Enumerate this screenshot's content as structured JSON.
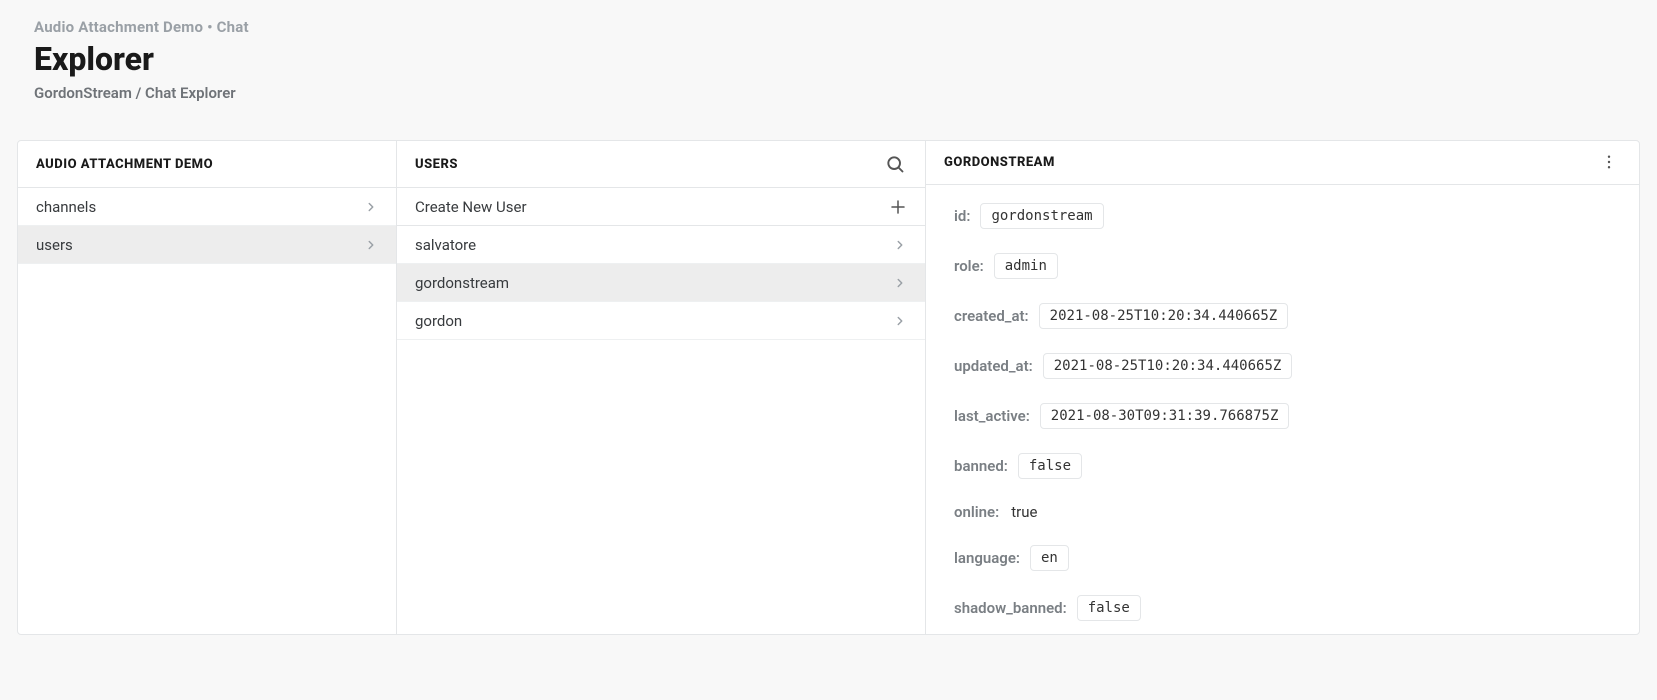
{
  "header": {
    "sup": "Audio Attachment Demo • Chat",
    "title": "Explorer",
    "breadcrumb": "GordonStream / Chat Explorer"
  },
  "panel_left": {
    "title": "Audio Attachment Demo",
    "items": [
      {
        "label": "channels",
        "selected": false
      },
      {
        "label": "users",
        "selected": true
      }
    ]
  },
  "panel_middle": {
    "title": "Users",
    "create_label": "Create New User",
    "items": [
      {
        "label": "salvatore",
        "selected": false
      },
      {
        "label": "gordonstream",
        "selected": true
      },
      {
        "label": "gordon",
        "selected": false
      }
    ]
  },
  "panel_right": {
    "title": "GordonStream",
    "fields": [
      {
        "label": "id:",
        "value": "gordonstream",
        "code": true
      },
      {
        "label": "role:",
        "value": "admin",
        "code": true
      },
      {
        "label": "created_at:",
        "value": "2021-08-25T10:20:34.440665Z",
        "code": true
      },
      {
        "label": "updated_at:",
        "value": "2021-08-25T10:20:34.440665Z",
        "code": true
      },
      {
        "label": "last_active:",
        "value": "2021-08-30T09:31:39.766875Z",
        "code": true
      },
      {
        "label": "banned:",
        "value": "false",
        "code": true
      },
      {
        "label": "online:",
        "value": "true",
        "code": false
      },
      {
        "label": "language:",
        "value": "en",
        "code": true
      },
      {
        "label": "shadow_banned:",
        "value": "false",
        "code": true
      }
    ]
  }
}
